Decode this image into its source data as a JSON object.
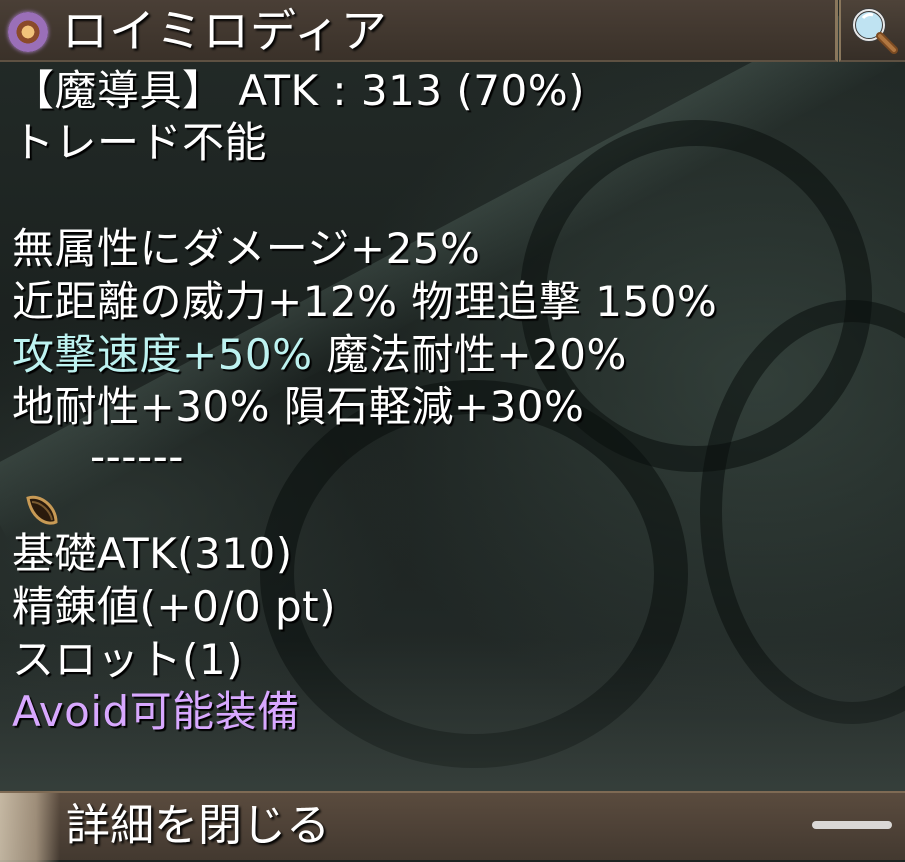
{
  "header": {
    "item_name": "ロイミロディア"
  },
  "stats": {
    "line_type_atk": "【魔導具】 ATK : 313 (70%)",
    "trade": "トレード不能",
    "effect_1": "無属性にダメージ+25%",
    "effect_2": "近距離の威力+12% 物理追撃 150%",
    "effect_3_highlight": "攻撃速度+50%",
    "effect_3_rest": " 魔法耐性+20%",
    "effect_4": "地耐性+30% 隕石軽減+30%",
    "slot_empty": "------",
    "base_atk": "基礎ATK(310)",
    "refine": "精錬値(+0/0 pt)",
    "slots": "スロット(1)",
    "avoid": "Avoid可能装備"
  },
  "footer": {
    "close_label": "詳細を閉じる"
  },
  "icons": {
    "title": "item-orb-icon",
    "search": "magnifier-icon",
    "slot": "seed-card-icon"
  },
  "colors": {
    "highlight": "#bdf2f0",
    "avoid": "#d8a8ff",
    "text": "#ffffff"
  }
}
